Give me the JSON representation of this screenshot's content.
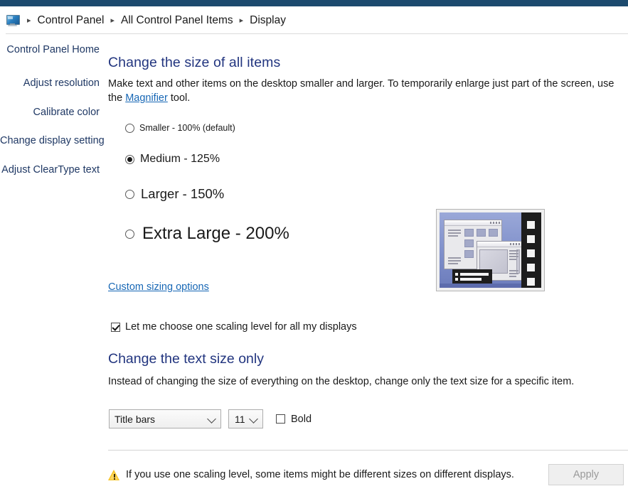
{
  "window": {
    "accent_color": "#1c4a6e",
    "heading_color": "#22357f",
    "link_color": "#1767b5",
    "nav_color": "#1f3864"
  },
  "addressbar": {
    "icon": "display-monitor-icon",
    "separator": "▸",
    "crumbs": [
      {
        "label": "Control Panel"
      },
      {
        "label": "All Control Panel Items"
      },
      {
        "label": "Display"
      }
    ]
  },
  "sidebar": {
    "items": [
      {
        "label": "Control Panel Home"
      },
      {
        "label": "Adjust resolution"
      },
      {
        "label": "Calibrate color"
      },
      {
        "label": "Change display settings"
      },
      {
        "label": "Adjust ClearType text"
      }
    ]
  },
  "main": {
    "size_section": {
      "title": "Change the size of all items",
      "desc_part1": "Make text and other items on the desktop smaller and larger. To temporarily enlarge just part of the screen, use the ",
      "desc_link": "Magnifier",
      "desc_part2": " tool.",
      "options": [
        {
          "label": "Smaller - 100% (default)",
          "value": 100,
          "selected": false
        },
        {
          "label": "Medium - 125%",
          "value": 125,
          "selected": true
        },
        {
          "label": "Larger - 150%",
          "value": 150,
          "selected": false
        },
        {
          "label": "Extra Large - 200%",
          "value": 200,
          "selected": false
        }
      ],
      "custom_link": "Custom sizing options",
      "scaling_checkbox": {
        "label": "Let me choose one scaling level for all my displays",
        "checked": true
      }
    },
    "preview": {
      "name": "desktop-preview-thumbnail"
    },
    "text_section": {
      "title": "Change the text size only",
      "desc": "Instead of changing the size of everything on the desktop, change only the text size for a specific item.",
      "item_select": {
        "value": "Title bars",
        "chevron": "chevron-down-icon"
      },
      "size_select": {
        "value": "11",
        "chevron": "chevron-down-icon"
      },
      "bold_checkbox": {
        "label": "Bold",
        "checked": false
      }
    }
  },
  "footer": {
    "warning_icon": "warning-triangle-icon",
    "warning_text": "If you use one scaling level, some items might be different sizes on different displays.",
    "apply_label": "Apply",
    "apply_enabled": false
  }
}
